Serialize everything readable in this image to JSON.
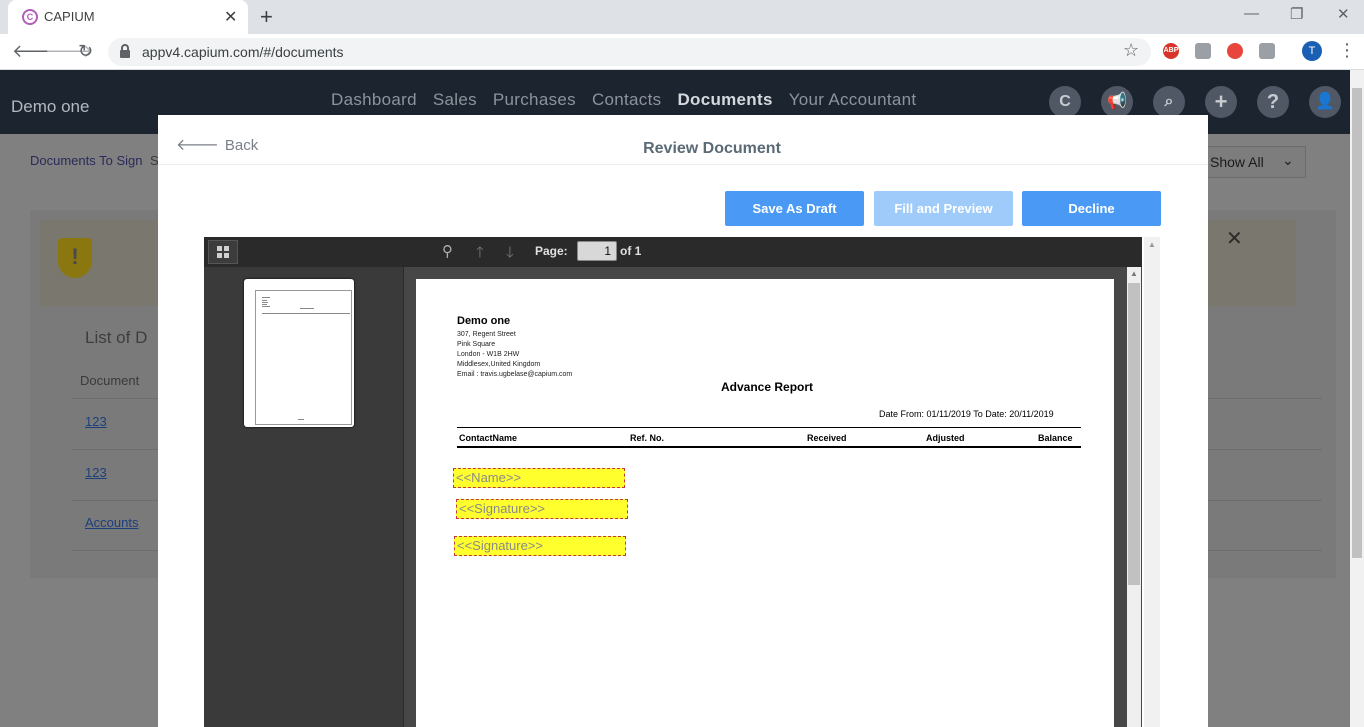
{
  "browser": {
    "tab_title": "CAPIUM",
    "url": "appv4.capium.com/#/documents",
    "profile_initial": "T",
    "abp_label": "ABP"
  },
  "app": {
    "company": "Demo one",
    "nav": [
      "Dashboard",
      "Sales",
      "Purchases",
      "Contacts",
      "Documents",
      "Your Accountant"
    ],
    "active_nav": "Documents",
    "subnav_first": "Documents To Sign",
    "subnav_second_partial": "S",
    "filter_label": "Show All",
    "list_title_partial": "List of D",
    "document_col": "Document",
    "rows": [
      "123",
      "123",
      "Accounts"
    ]
  },
  "modal": {
    "back_label": "Back",
    "title": "Review Document",
    "buttons": {
      "save_draft": "Save As Draft",
      "fill_preview": "Fill and Preview",
      "decline": "Decline"
    }
  },
  "viewer": {
    "page_label": "Page:",
    "current_page": "1",
    "of_label": "of 1"
  },
  "document": {
    "company": "Demo one",
    "address": [
      "307, Regent Street",
      "Pink Square",
      "London - W1B 2HW",
      "Middlesex,United Kingdom",
      "Email : travis.ugbelase@capium.com"
    ],
    "report_title": "Advance Report",
    "dates": "Date From: 01/11/2019  To Date: 20/11/2019",
    "columns": [
      "ContactName",
      "Ref. No.",
      "Received",
      "Adjusted",
      "Balance"
    ],
    "fields": {
      "name": "<<Name>>",
      "signature_1": "<<Signature>>",
      "signature_2": "<<Signature>>"
    }
  },
  "colors": {
    "primary_button": "#4a9af5",
    "disabled_button": "#9fcbfa",
    "field_fill": "#ffff2e",
    "field_border": "#c43838",
    "header_bg": "#1c2430"
  },
  "icons": [
    "favicon-icon",
    "close-tab-icon",
    "new-tab-icon",
    "back-arrow-icon",
    "forward-arrow-icon",
    "reload-icon",
    "lock-icon",
    "star-icon",
    "megaphone-icon",
    "search-icon",
    "plus-icon",
    "help-icon",
    "user-icon",
    "shield-warning-icon",
    "close-icon",
    "grid-icon",
    "magnifier-icon",
    "arrow-up-icon",
    "arrow-down-icon"
  ]
}
